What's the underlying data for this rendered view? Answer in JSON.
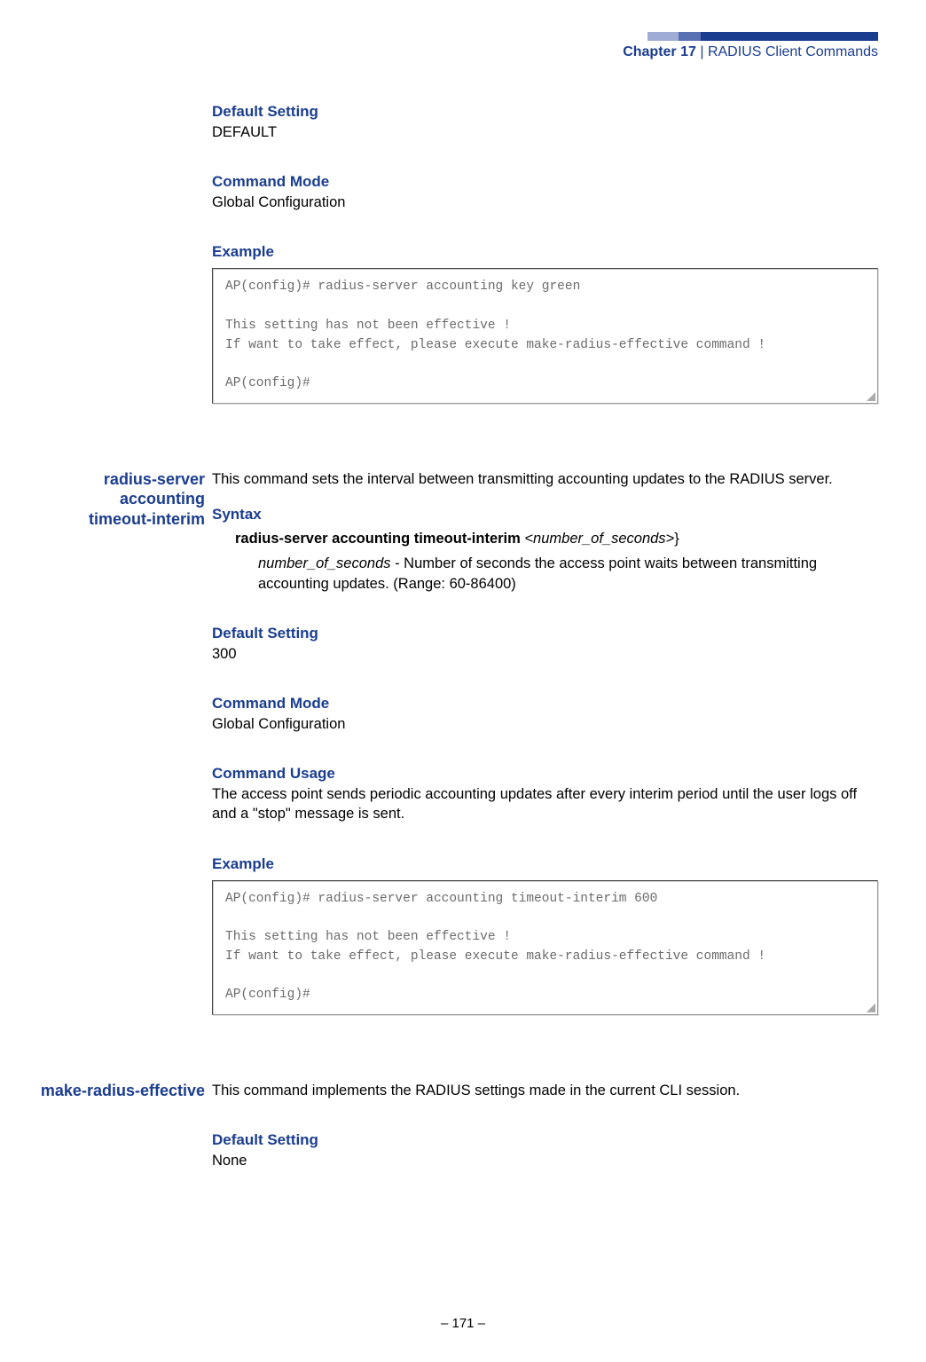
{
  "header": {
    "chapter_label": "Chapter 17",
    "separator": "  |  ",
    "title": "RADIUS Client Commands"
  },
  "cmd1": {
    "default_setting_h": "Default Setting",
    "default_setting_v": "DEFAULT",
    "command_mode_h": "Command Mode",
    "command_mode_v": "Global Configuration",
    "example_h": "Example",
    "code": "AP(config)# radius-server accounting key green\n\nThis setting has not been effective !\nIf want to take effect, please execute make-radius-effective command !\n\nAP(config)#"
  },
  "cmd2": {
    "name_l1": "radius-server",
    "name_l2": "accounting",
    "name_l3": "timeout-interim",
    "desc": "This command sets the interval between transmitting accounting updates to the RADIUS server.",
    "syntax_h": "Syntax",
    "syntax_bold": "radius-server accounting timeout-interim ",
    "syntax_arg": "<number_of_seconds>",
    "syntax_tail": "}",
    "param_name": "number_of_seconds",
    "param_desc": " - Number of seconds the access point waits between transmitting accounting updates. (Range: 60-86400)",
    "default_setting_h": "Default Setting",
    "default_setting_v": "300",
    "command_mode_h": "Command Mode",
    "command_mode_v": "Global Configuration",
    "command_usage_h": "Command Usage",
    "command_usage_v": "The access point sends periodic accounting updates after every interim period until the user logs off and a \"stop\" message is sent.",
    "example_h": "Example",
    "code": "AP(config)# radius-server accounting timeout-interim 600\n\nThis setting has not been effective !\nIf want to take effect, please execute make-radius-effective command !\n\nAP(config)#"
  },
  "cmd3": {
    "name": "make-radius-effective",
    "desc": "This command implements the RADIUS settings made in the current CLI session.",
    "default_setting_h": "Default Setting",
    "default_setting_v": "None"
  },
  "footer": "–  171  –"
}
